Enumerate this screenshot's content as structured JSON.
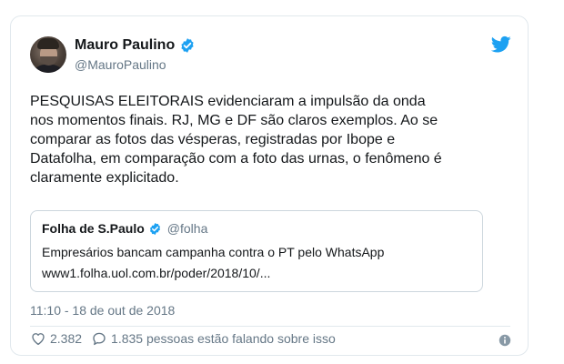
{
  "tweet": {
    "author_name": "Mauro Paulino",
    "author_handle": "@MauroPaulino",
    "text": "PESQUISAS ELEITORAIS evidenciaram a impulsão da onda\nnos momentos finais. RJ, MG e DF são claros exemplos. Ao se\ncomparar as fotos das vésperas, registradas por Ibope e\nDatafolha, em comparação com a foto das urnas, o fenômeno é\nclaramente explicitado.",
    "timestamp": "11:10 - 18 de out de 2018"
  },
  "quoted_tweet": {
    "name": "Folha de S.Paulo",
    "handle": "@folha",
    "text": "Empresários bancam campanha contra o PT pelo WhatsApp",
    "link": "www1.folha.uol.com.br/poder/2018/10/..."
  },
  "actions": {
    "likes": "2.382",
    "conversation": "1.835 pessoas estão falando sobre isso"
  },
  "icons": {
    "brand": "twitter-bird-icon",
    "verified": "verified-badge-icon",
    "like": "heart-icon",
    "reply": "speech-bubble-icon",
    "info": "info-icon"
  },
  "colors": {
    "twitter_blue": "#1da1f2",
    "text_primary": "#14171a",
    "text_secondary": "#657786",
    "border": "#e1e8ed"
  }
}
